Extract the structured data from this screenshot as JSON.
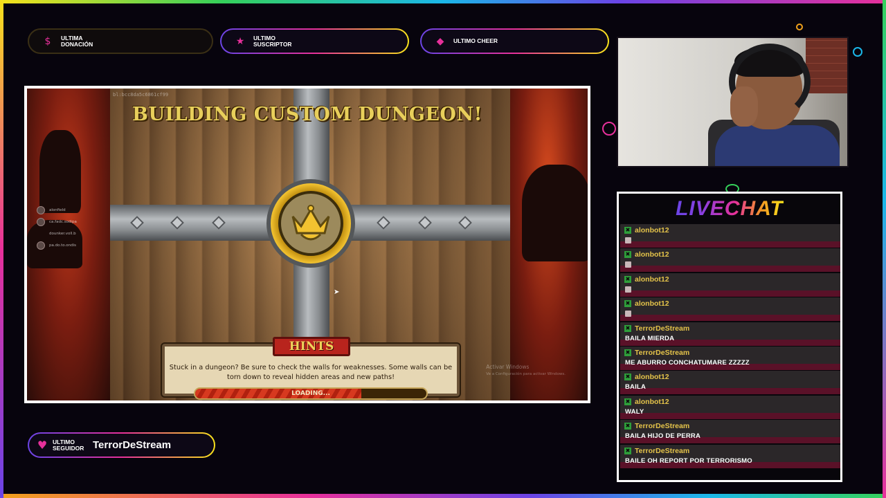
{
  "alerts": {
    "donation": {
      "label": "ULTIMA DONACIÓN",
      "value": "",
      "icon": "dollar-icon"
    },
    "subscriber": {
      "label": "ULTIMO SUSCRIPTOR",
      "value": "",
      "icon": "star-icon"
    },
    "cheer": {
      "label": "ULTIMO CHEER",
      "value": "",
      "icon": "diamond-icon"
    },
    "follower": {
      "label": "ULTIMO SEGUIDOR",
      "value": "TerrorDeStream",
      "icon": "heart-icon"
    }
  },
  "game": {
    "build_id": "bl:bcc8da5c6861cf99",
    "title": "BUILDING CUSTOM DUNGEON!",
    "hints_title": "HINTS",
    "hints_text": "Stuck in a dungeon? Be sure to check the walls for weaknesses. Some walls can be torn down to reveal hidden areas and new paths!",
    "loading_text": "LOADING...",
    "loading_progress": 0.72,
    "windows_watermark_title": "Activar Windows",
    "windows_watermark_sub": "Ve a Configuración para activar Windows.",
    "side_players": [
      "alonfield",
      "ca.fadc.sodipa",
      "dounker.voll.b",
      "pa.do.to.ondis"
    ]
  },
  "chat": {
    "title": "LIVECHAT",
    "messages": [
      {
        "user": "alonbot12",
        "text": "",
        "emote": true
      },
      {
        "user": "alonbot12",
        "text": "",
        "emote": true
      },
      {
        "user": "alonbot12",
        "text": "",
        "emote": true
      },
      {
        "user": "alonbot12",
        "text": "",
        "emote": true
      },
      {
        "user": "TerrorDeStream",
        "text": "BAILA MIERDA",
        "emote": false
      },
      {
        "user": "TerrorDeStream",
        "text": "ME ABURRO CONCHATUMARE ZZZZZ",
        "emote": false
      },
      {
        "user": "alonbot12",
        "text": "BAILA",
        "emote": false
      },
      {
        "user": "alonbot12",
        "text": "WALY",
        "emote": false
      },
      {
        "user": "TerrorDeStream",
        "text": "BAILA HIJO DE PERRA",
        "emote": false
      },
      {
        "user": "TerrorDeStream",
        "text": "BAILE OH REPORT POR TERRORISMO",
        "emote": false
      }
    ]
  },
  "colors": {
    "accent_pink": "#e7309b",
    "accent_purple": "#6a44e6",
    "accent_yellow": "#f7e21b",
    "chat_username": "#e5c44a",
    "chat_row_bottom": "#5a1128"
  }
}
